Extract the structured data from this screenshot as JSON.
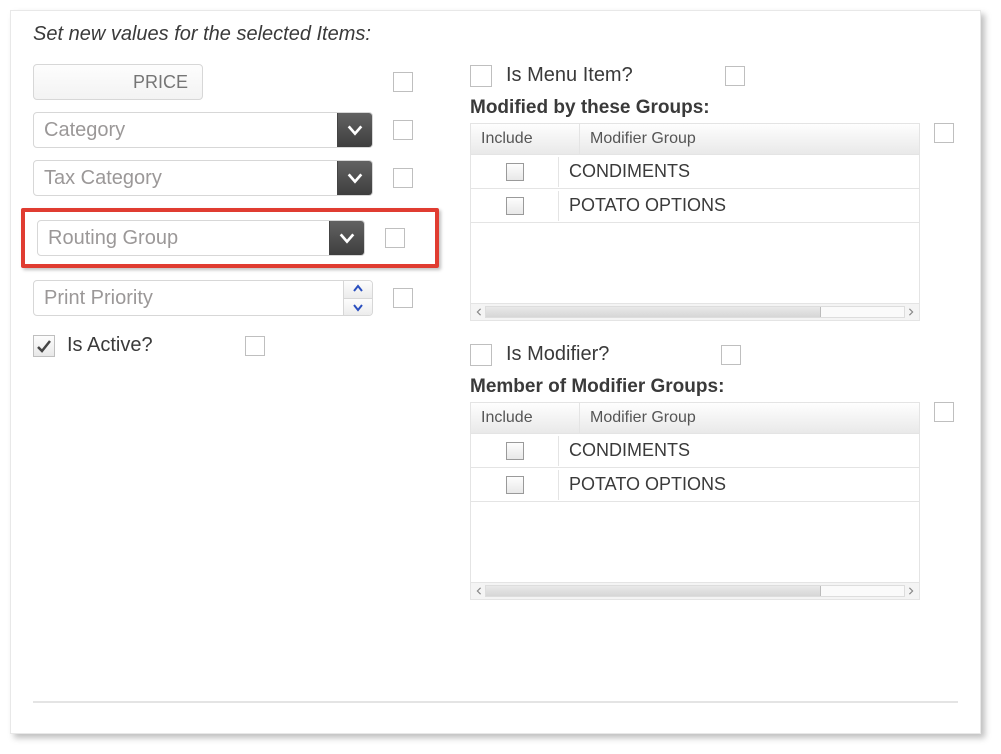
{
  "heading": "Set new values for the selected Items:",
  "left": {
    "price_placeholder": "PRICE",
    "category_placeholder": "Category",
    "tax_category_placeholder": "Tax Category",
    "routing_group_placeholder": "Routing Group",
    "print_priority_placeholder": "Print Priority",
    "is_active_label": "Is Active?",
    "is_active_checked": "true"
  },
  "right": {
    "is_menu_item_label": "Is Menu Item?",
    "modified_by_title": "Modified by these Groups:",
    "is_modifier_label": "Is Modifier?",
    "member_of_title": "Member of Modifier Groups:",
    "columns": {
      "include": "Include",
      "modifier_group": "Modifier Group"
    },
    "modified_by_groups": [
      "CONDIMENTS",
      "POTATO OPTIONS"
    ],
    "member_of_groups": [
      "CONDIMENTS",
      "POTATO OPTIONS"
    ]
  }
}
